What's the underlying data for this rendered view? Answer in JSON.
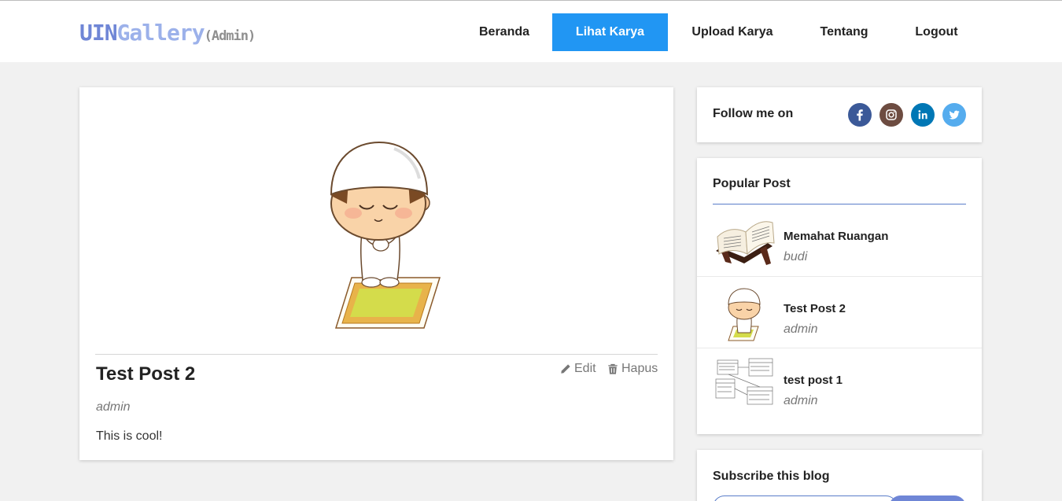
{
  "brand": {
    "part1": "UIN",
    "part2": "Gallery",
    "part3": "(Admin)"
  },
  "nav": [
    {
      "label": "Beranda",
      "active": false
    },
    {
      "label": "Lihat Karya",
      "active": true
    },
    {
      "label": "Upload Karya",
      "active": false
    },
    {
      "label": "Tentang",
      "active": false
    },
    {
      "label": "Logout",
      "active": false
    }
  ],
  "post": {
    "title": "Test Post 2",
    "author": "admin",
    "body": "This is cool!",
    "edit_label": "Edit",
    "delete_label": "Hapus",
    "image": "praying-boy-illustration"
  },
  "follow": {
    "label": "Follow me on",
    "icons": [
      {
        "name": "facebook-icon",
        "color": "#3b5998"
      },
      {
        "name": "instagram-icon",
        "color": "#6d4c41"
      },
      {
        "name": "linkedin-icon",
        "color": "#0077b5"
      },
      {
        "name": "twitter-icon",
        "color": "#55acee"
      }
    ]
  },
  "popular": {
    "title": "Popular Post",
    "items": [
      {
        "title": "Memahat Ruangan",
        "author": "budi",
        "thumb": "open-book-thumbnail"
      },
      {
        "title": "Test Post 2",
        "author": "admin",
        "thumb": "praying-boy-thumbnail"
      },
      {
        "title": "test post 1",
        "author": "admin",
        "thumb": "diagram-thumbnail"
      }
    ]
  },
  "subscribe": {
    "title": "Subscribe this blog"
  },
  "colors": {
    "accent": "#2196f3",
    "brand": "#6f86d6",
    "divider": "#5a7dc9"
  }
}
